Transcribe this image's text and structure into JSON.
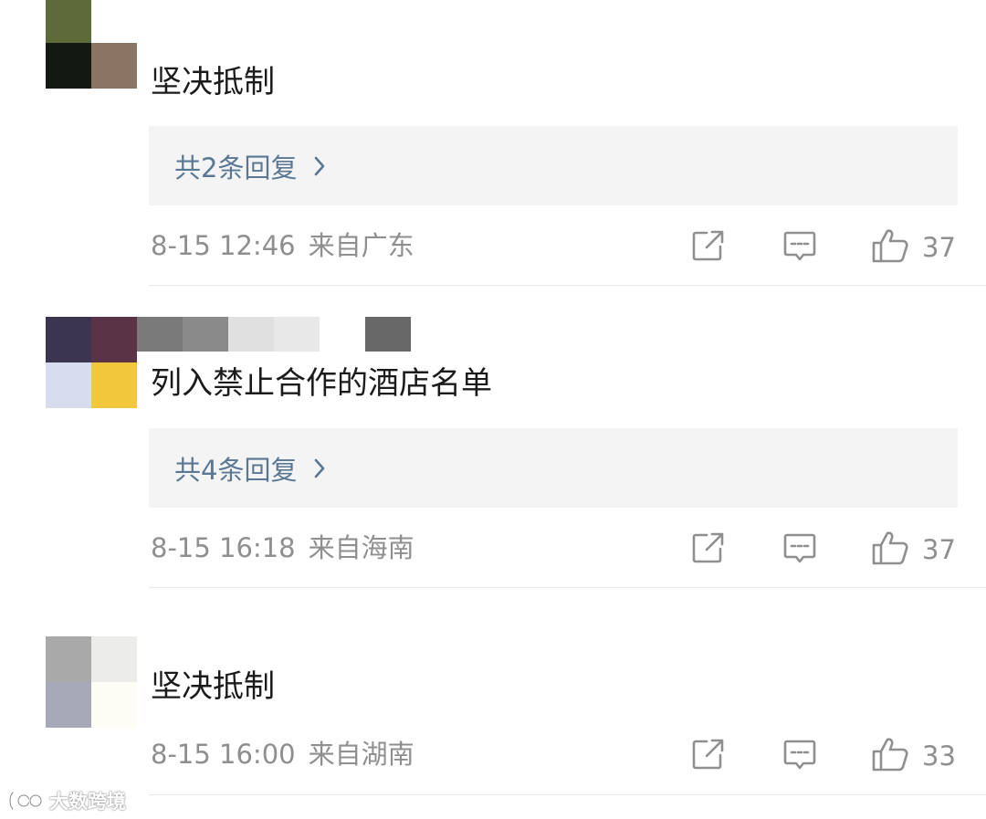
{
  "comments": [
    {
      "text": "坚决抵制",
      "reply_label": "共2条回复",
      "time": "8-15 12:46",
      "location": "来自广东",
      "likes": "37",
      "avatar_colors": [
        "#5d6b3a",
        "#141812",
        "#8a7565"
      ]
    },
    {
      "text": "列入禁止合作的酒店名单",
      "reply_label": "共4条回复",
      "time": "8-15 16:18",
      "location": "来自海南",
      "likes": "37",
      "avatar_colors": [
        "#3c3550",
        "#5a3446",
        "#7a7a7a",
        "#8a8a8a",
        "#e0e0e0",
        "#e8e8e8",
        "#ffffff",
        "#686868",
        "#d8dcef",
        "#f2c73c"
      ]
    },
    {
      "text": "坚决抵制",
      "reply_label": "",
      "time": "8-15 16:00",
      "location": "来自湖南",
      "likes": "33",
      "avatar_colors": [
        "#a9a9a9",
        "#ececeb",
        "#a7a9b8",
        "#fdfdf6"
      ]
    }
  ],
  "icons": {
    "share": "share-icon",
    "comment": "comment-icon",
    "like": "thumbs-up-icon"
  },
  "colors": {
    "reply_link": "#5a7794",
    "meta_text": "#8f8f8f",
    "reply_bg": "#f4f4f4"
  },
  "watermark": {
    "text": "大数跨境"
  }
}
